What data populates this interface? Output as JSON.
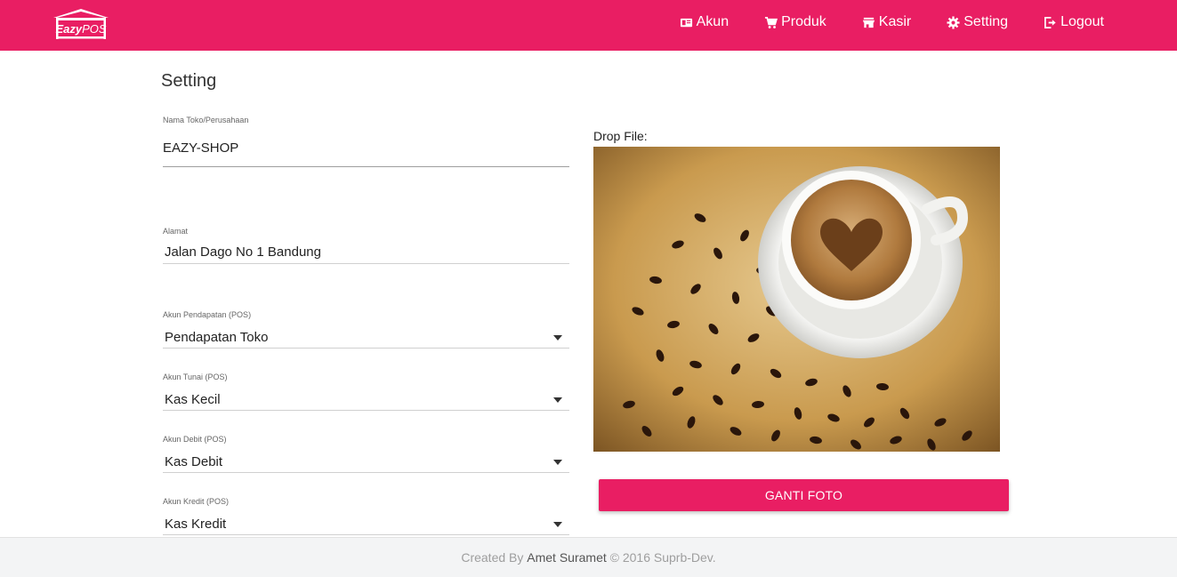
{
  "app": {
    "logo_text": "EazyPOS"
  },
  "nav": {
    "items": [
      {
        "label": "Akun",
        "icon": "book-icon"
      },
      {
        "label": "Produk",
        "icon": "cart-icon"
      },
      {
        "label": "Kasir",
        "icon": "store-icon"
      },
      {
        "label": "Setting",
        "icon": "gear-icon"
      },
      {
        "label": "Logout",
        "icon": "logout-icon"
      }
    ]
  },
  "page": {
    "title": "Setting"
  },
  "form": {
    "nama_toko": {
      "label": "Nama Toko/Perusahaan",
      "value": "EAZY-SHOP"
    },
    "alamat": {
      "label": "Alamat",
      "value": "Jalan Dago No 1 Bandung"
    },
    "akun_pendapatan": {
      "label": "Akun Pendapatan (POS)",
      "value": "Pendapatan Toko"
    },
    "akun_tunai": {
      "label": "Akun Tunai (POS)",
      "value": "Kas Kecil"
    },
    "akun_debit": {
      "label": "Akun Debit (POS)",
      "value": "Kas Debit"
    },
    "akun_kredit": {
      "label": "Akun Kredit (POS)",
      "value": "Kas Kredit"
    }
  },
  "upload": {
    "drop_label": "Drop File:",
    "photo_subject": "coffee-cup-with-beans",
    "button_label": "GANTI FOTO"
  },
  "footer": {
    "prefix": "Created By",
    "author": "Amet Suramet",
    "suffix": "© 2016 Suprb-Dev."
  },
  "colors": {
    "primary": "#e91e63",
    "footer_bg": "#f3f4f5"
  }
}
